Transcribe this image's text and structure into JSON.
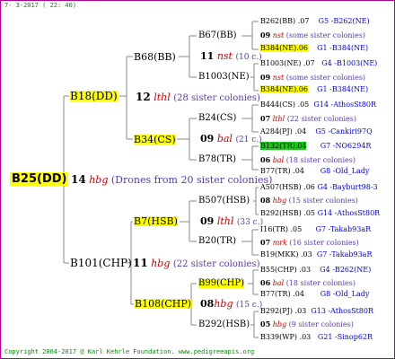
{
  "header": "7- 3-2017 ( 22: 40)",
  "footer": "Copyright 2004-2017 @ Karl Kehrle Foundation.   www.pedigreeapis.org",
  "root": "B25(DD)",
  "drones": {
    "num": "14",
    "aff": "hbg",
    "text": "(Drones from 20 sister colonies)"
  },
  "gen1": [
    {
      "name": "B18(DD)",
      "num": "12",
      "aff": "lthl",
      "sis": "(28 sister colonies)"
    },
    {
      "name": "B101(CHP)",
      "num": "11",
      "aff": "hbg",
      "sis": "(22 sister colonies)"
    }
  ],
  "gen2": [
    {
      "name": "B68(BB)",
      "num": "11",
      "aff": "nst",
      "sis": "(10 c.)"
    },
    {
      "name": "B34(CS)",
      "num": "09",
      "aff": "bal",
      "sis": "(21 c.)"
    },
    {
      "name": "B7(HSB)",
      "num": "09",
      "aff": "lthl",
      "sis": "(33 c.)"
    },
    {
      "name": "B108(CHP)",
      "num": "08",
      "aff": "hbg",
      "sis": "(15 c.)"
    }
  ],
  "gen3": [
    "B67(BB)",
    "B1003(NE)",
    "B24(CS)",
    "B78(TR)",
    "B507(HSB)",
    "B20(TR)",
    "B99(CHP)",
    "B292(HSB)"
  ],
  "gen4": [
    {
      "name": "B262(BB)",
      "yr": ".07",
      "src": "G5 -B262(NE)"
    },
    {
      "num": "09",
      "aff": "nst",
      "sis": "(some sister colonies)"
    },
    {
      "name": "B384(NE)",
      "yr": ".06",
      "src": "G1 -B384(NE)"
    },
    {
      "name": "B1003(NE)",
      "yr": ".07",
      "src": "G4 -B1003(NE)"
    },
    {
      "num": "09",
      "aff": "nst",
      "sis": "(some sister colonies)"
    },
    {
      "name": "B384(NE)",
      "yr": ".06",
      "src": "G1 -B384(NE)"
    },
    {
      "name": "B444(CS)",
      "yr": ".05",
      "src": "G14 -AthosSt80R"
    },
    {
      "num": "07",
      "aff": "lthl",
      "sis": "(22 sister colonies)"
    },
    {
      "name": "A284(PJ)",
      "yr": ".04",
      "src": "G5 -Cankiri97Q"
    },
    {
      "name": "B132(TR)",
      "yr": ".04",
      "src": "G7 -NO6294R"
    },
    {
      "num": "06",
      "aff": "bal",
      "sis": "(18 sister colonies)"
    },
    {
      "name": "B77(TR)",
      "yr": ".04",
      "src": "G8 -Old_Lady"
    },
    {
      "name": "A507(HSB)",
      "yr": ".06",
      "src": "G4 -Bayburt98-3"
    },
    {
      "num": "08",
      "aff": "hbg",
      "sis": "(15 sister colonies)"
    },
    {
      "name": "B292(HSB)",
      "yr": ".05",
      "src": "G14 -AthosSt80R"
    },
    {
      "name": "I16(TR)",
      "yr": ".05",
      "src": "G7 -Takab93aR"
    },
    {
      "num": "07",
      "aff": "mrk",
      "sis": "(16 sister colonies)"
    },
    {
      "name": "B19(MKK)",
      "yr": ".03",
      "src": "G7 -Takab93aR"
    },
    {
      "name": "B55(CHP)",
      "yr": ".03",
      "src": "G4 -B262(NE)"
    },
    {
      "num": "06",
      "aff": "bal",
      "sis": "(18 sister colonies)"
    },
    {
      "name": "B77(TR)",
      "yr": ".04",
      "src": "G8 -Old_Lady"
    },
    {
      "name": "B292(PJ)",
      "yr": ".03",
      "src": "G13 -AthosSt80R"
    },
    {
      "num": "05",
      "aff": "hbg",
      "sis": "(9 sister colonies)"
    },
    {
      "name": "B339(WP)",
      "yr": ".03",
      "src": "G21 -Sinop62R"
    }
  ],
  "colors": {
    "frame": "#b3008a",
    "highlight": "#ffff00",
    "highlight_green": "#19cc19",
    "affiliation": "#cc0000",
    "sister": "#5a3aa8",
    "source": "#0000cc",
    "text_green": "#0b8a0b"
  }
}
